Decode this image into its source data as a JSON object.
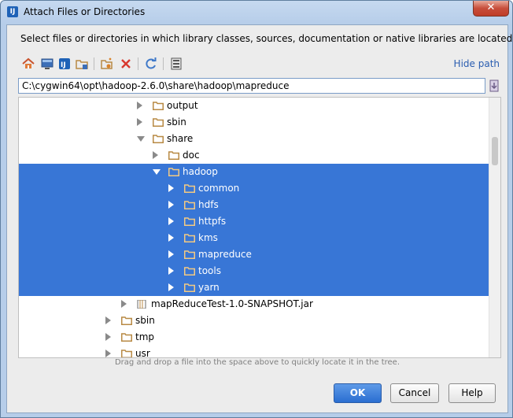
{
  "window": {
    "title": "Attach Files or Directories",
    "close_glyph": "✕"
  },
  "description": "Select files or directories in which library classes, sources, documentation or native libraries are located",
  "toolbar": {
    "buttons": [
      "home-icon",
      "desktop-icon",
      "project-icon",
      "module-icon",
      "new-folder-icon",
      "delete-icon",
      "refresh-icon",
      "show-hidden-icon"
    ],
    "hide_path_label": "Hide path"
  },
  "path": {
    "value": "C:\\cygwin64\\opt\\hadoop-2.6.0\\share\\hadoop\\mapreduce"
  },
  "tree": {
    "rows": [
      {
        "label": "output",
        "expanded": false,
        "level": 4,
        "kind": "folder",
        "selected": false
      },
      {
        "label": "sbin",
        "expanded": false,
        "level": 4,
        "kind": "folder",
        "selected": false
      },
      {
        "label": "share",
        "expanded": true,
        "level": 4,
        "kind": "folder",
        "selected": false
      },
      {
        "label": "doc",
        "expanded": false,
        "level": 5,
        "kind": "folder",
        "selected": false
      },
      {
        "label": "hadoop",
        "expanded": true,
        "level": 5,
        "kind": "folder",
        "selected": true
      },
      {
        "label": "common",
        "expanded": false,
        "level": 6,
        "kind": "folder",
        "selected": true
      },
      {
        "label": "hdfs",
        "expanded": false,
        "level": 6,
        "kind": "folder",
        "selected": true
      },
      {
        "label": "httpfs",
        "expanded": false,
        "level": 6,
        "kind": "folder",
        "selected": true
      },
      {
        "label": "kms",
        "expanded": false,
        "level": 6,
        "kind": "folder",
        "selected": true
      },
      {
        "label": "mapreduce",
        "expanded": false,
        "level": 6,
        "kind": "folder",
        "selected": true
      },
      {
        "label": "tools",
        "expanded": false,
        "level": 6,
        "kind": "folder",
        "selected": true
      },
      {
        "label": "yarn",
        "expanded": false,
        "level": 6,
        "kind": "folder",
        "selected": true
      },
      {
        "label": "mapReduceTest-1.0-SNAPSHOT.jar",
        "expanded": false,
        "level": 3,
        "kind": "jar",
        "selected": false
      },
      {
        "label": "sbin",
        "expanded": false,
        "level": 2,
        "kind": "folder",
        "selected": false
      },
      {
        "label": "tmp",
        "expanded": false,
        "level": 2,
        "kind": "folder",
        "selected": false
      },
      {
        "label": "usr",
        "expanded": false,
        "level": 2,
        "kind": "folder",
        "selected": false
      }
    ]
  },
  "hint": "Drag and drop a file into the space above to quickly locate it in the tree.",
  "buttons": {
    "ok": "OK",
    "cancel": "Cancel",
    "help": "Help"
  },
  "colors": {
    "selection": "#3876d6",
    "folder": "#b88a44",
    "link": "#2a5db0"
  }
}
